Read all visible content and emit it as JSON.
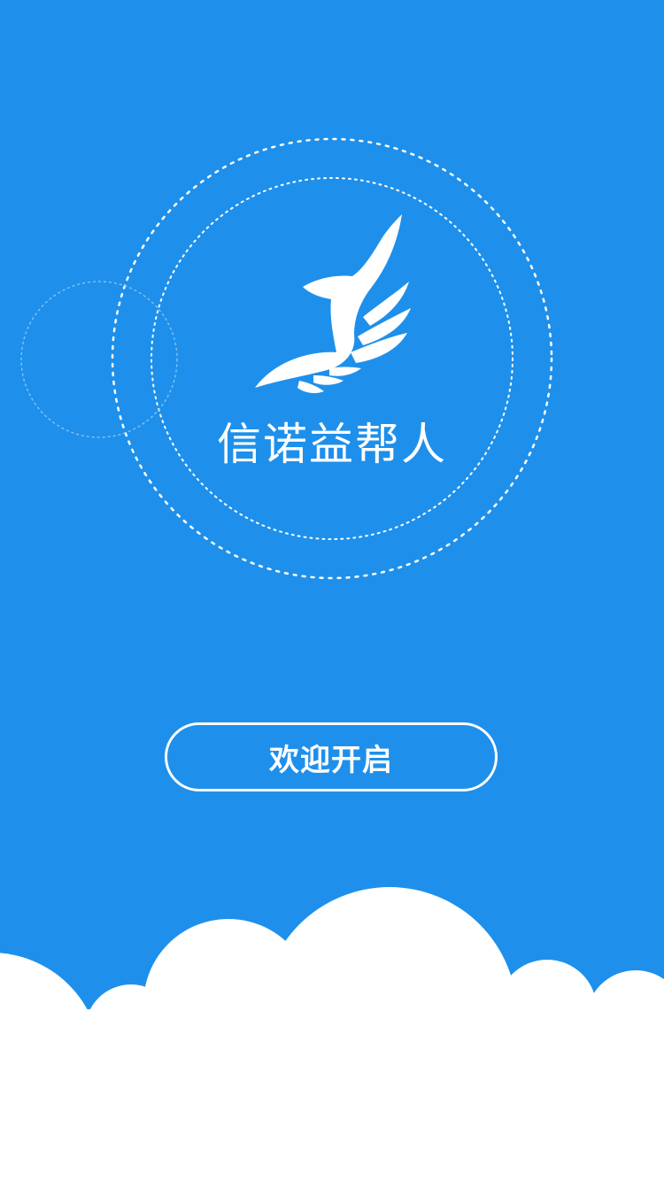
{
  "app": {
    "name": "信诺益帮人"
  },
  "welcome": {
    "start_label": "欢迎开启"
  },
  "icons": {
    "logo": "eagle-wing-logo",
    "clouds": "cloud-decoration",
    "rings": "dotted-ring-decoration"
  },
  "colors": {
    "background": "#1e90eb",
    "foreground": "#ffffff"
  }
}
